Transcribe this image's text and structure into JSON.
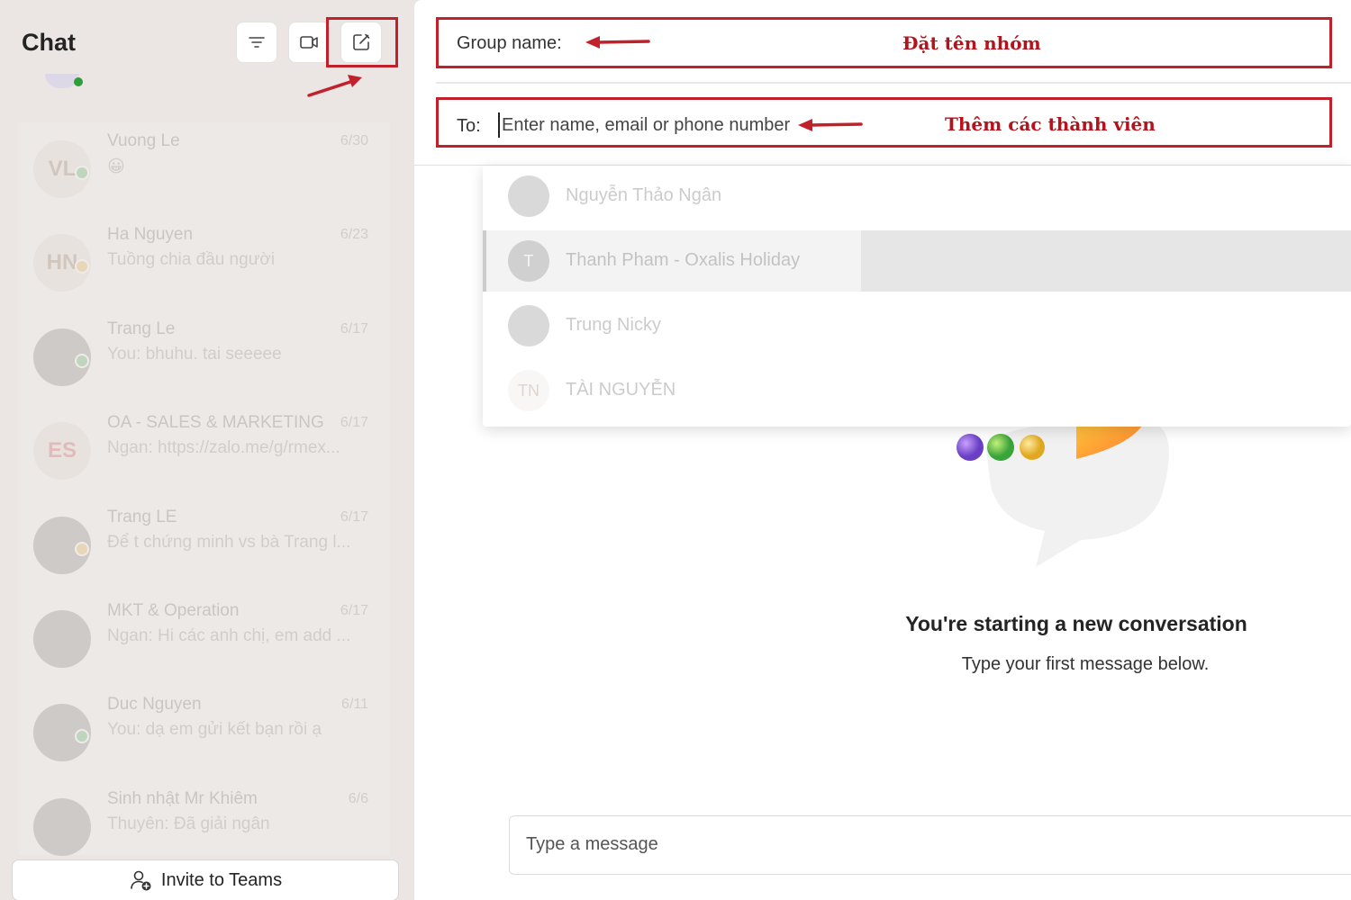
{
  "sidebar": {
    "title": "Chat",
    "chats": [
      {
        "name": "Vuong Le",
        "time": "6/30",
        "preview": "😀",
        "initials": "VL",
        "status": "online"
      },
      {
        "name": "Ha Nguyen",
        "time": "6/23",
        "preview": "Tuồng chia đầu người",
        "initials": "HN",
        "status": "away"
      },
      {
        "name": "Trang Le",
        "time": "6/17",
        "preview": "You: bhuhu. tai seeeee",
        "initials": "",
        "status": "online"
      },
      {
        "name": "OA - SALES & MARKETING",
        "time": "6/17",
        "preview": "Ngan: https://zalo.me/g/rmex...",
        "initials": "ES",
        "status": ""
      },
      {
        "name": "Trang LE",
        "time": "6/17",
        "preview": "Để t chứng minh vs bà Trang l...",
        "initials": "",
        "status": "away"
      },
      {
        "name": "MKT & Operation",
        "time": "6/17",
        "preview": "Ngan: Hi các anh chị, em add ...",
        "initials": "",
        "status": ""
      },
      {
        "name": "Duc Nguyen",
        "time": "6/11",
        "preview": "You: dạ em gửi kết bạn rồi ạ",
        "initials": "",
        "status": "online"
      },
      {
        "name": "Sinh nhật Mr Khiêm",
        "time": "6/6",
        "preview": "Thuyên: Đã giải ngân",
        "initials": "",
        "status": ""
      }
    ],
    "invite_label": "Invite to Teams"
  },
  "header": {
    "group_label": "Group name:",
    "group_annotation": "Đặt tên nhóm",
    "to_label": "To:",
    "to_placeholder": "Enter name, email or phone number",
    "to_annotation": "Thêm các thành viên"
  },
  "suggestions": [
    {
      "name": "Nguyễn Thảo Ngân",
      "initials": ""
    },
    {
      "name": "Thanh Pham - Oxalis Holiday",
      "initials": "T"
    },
    {
      "name": "Trung Nicky",
      "initials": ""
    },
    {
      "name": "TÀI NGUYỄN",
      "initials": "TN"
    }
  ],
  "empty_state": {
    "title": "You're starting a new conversation",
    "subtitle": "Type your first message below."
  },
  "compose": {
    "placeholder": "Type a message"
  },
  "colors": {
    "annotation_red": "#c0212a",
    "accent": "#5b5fc7"
  }
}
